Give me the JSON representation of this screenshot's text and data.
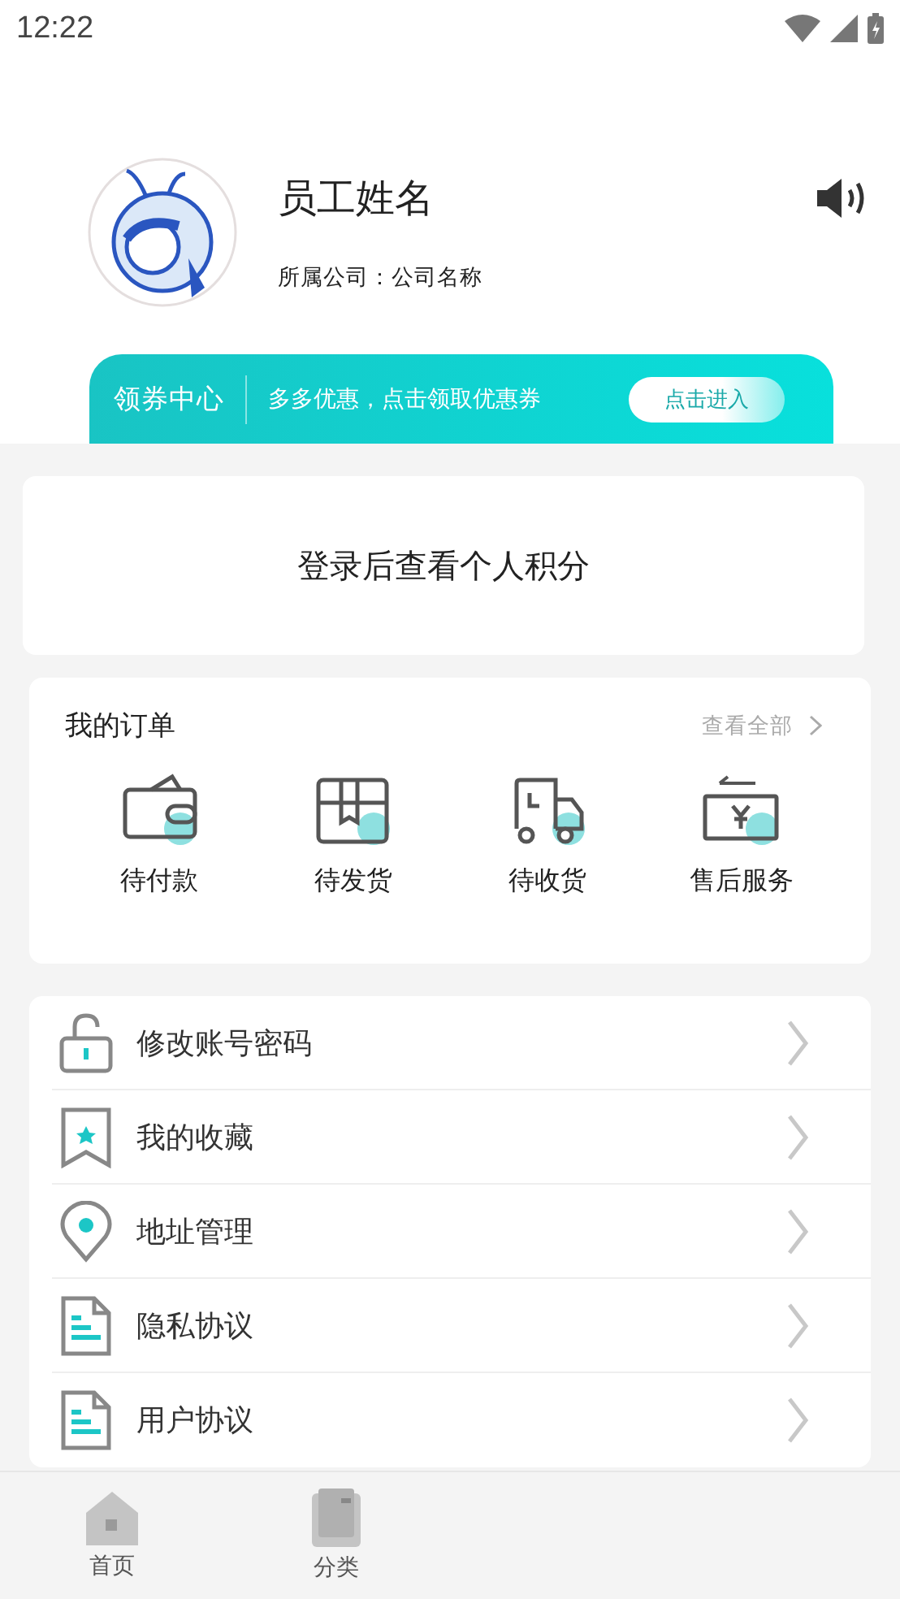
{
  "status_bar": {
    "time": "12:22"
  },
  "profile": {
    "name": "员工姓名",
    "company": "所属公司：公司名称"
  },
  "coupon_banner": {
    "title": "领券中心",
    "text": "多多优惠，点击领取优惠券",
    "button": "点击进入"
  },
  "points_card": {
    "text": "登录后查看个人积分"
  },
  "orders": {
    "title": "我的订单",
    "view_all": "查看全部",
    "items": [
      {
        "kind": "wallet",
        "label": "待付款"
      },
      {
        "kind": "box",
        "label": "待发货"
      },
      {
        "kind": "truck",
        "label": "待收货"
      },
      {
        "kind": "refund",
        "label": "售后服务"
      }
    ]
  },
  "menu": [
    {
      "kind": "lock",
      "label": "修改账号密码"
    },
    {
      "kind": "bookmark",
      "label": "我的收藏"
    },
    {
      "kind": "pin",
      "label": "地址管理"
    },
    {
      "kind": "doc",
      "label": "隐私协议"
    },
    {
      "kind": "doc",
      "label": "用户协议"
    }
  ],
  "bottom_nav": [
    {
      "kind": "home",
      "label": "首页"
    },
    {
      "kind": "category",
      "label": "分类"
    }
  ]
}
